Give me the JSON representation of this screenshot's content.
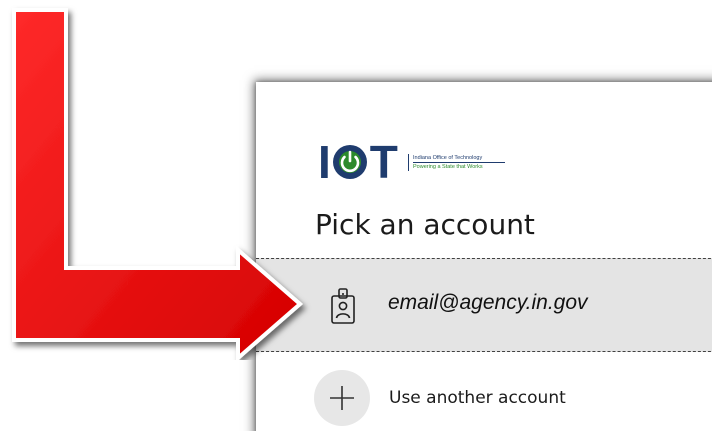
{
  "logo": {
    "letters_left": "I",
    "letters_right": "T",
    "org_name": "Indiana Office of Technology",
    "tagline": "Powering a State that Works"
  },
  "picker": {
    "title": "Pick an account",
    "account": {
      "email": "email@agency.in.gov",
      "icon": "id-badge-icon"
    },
    "use_another": {
      "label": "Use another account",
      "icon": "plus-icon"
    }
  },
  "annotation": {
    "arrow_color": "#e10000",
    "arrow_direction": "down-then-right",
    "points_to": "account"
  },
  "colors": {
    "brand_navy": "#1f3c6e",
    "brand_green": "#2c8a2c",
    "selected_row_bg": "#e4e4e4"
  }
}
